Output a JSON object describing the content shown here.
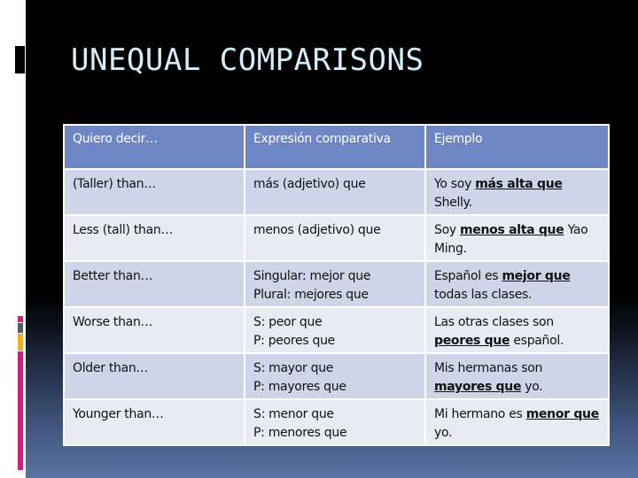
{
  "slide": {
    "title": "UNEQUAL COMPARISONS",
    "colors": {
      "background_top": "#000000",
      "background_bottom": "#5a74a5",
      "title_text": "#d7eefa",
      "header_fill": "#6f86c4",
      "row_odd_fill": "#cfd5e9",
      "row_even_fill": "#e8ebf4",
      "accent_magenta": "#d81b7a",
      "accent_gray": "#555a66",
      "accent_amber": "#f2ae1c"
    }
  },
  "table": {
    "headers": [
      "Quiero decir…",
      "Expresión comparativa",
      "Ejemplo"
    ],
    "rows": [
      {
        "meaning": "(Taller) than…",
        "expression": [
          "más (adjetivo) que"
        ],
        "example": {
          "before": "Yo soy ",
          "underlined": "más alta que",
          "after": " Shelly."
        }
      },
      {
        "meaning": "Less (tall) than…",
        "expression": [
          "menos (adjetivo) que"
        ],
        "example": {
          "before": "Soy ",
          "underlined": "menos alta que",
          "after": " Yao Ming."
        }
      },
      {
        "meaning": "Better than…",
        "expression": [
          "Singular: mejor que",
          "Plural: mejores que"
        ],
        "example": {
          "before": "Español es ",
          "underlined": "mejor que",
          "after": " todas las clases."
        }
      },
      {
        "meaning": "Worse than…",
        "expression": [
          "S: peor que",
          "P: peores que"
        ],
        "example": {
          "before": "Las otras clases son ",
          "underlined": "peores que",
          "after": " español."
        }
      },
      {
        "meaning": "Older than…",
        "expression": [
          "S: mayor que",
          "P: mayores que"
        ],
        "example": {
          "before": "Mis hermanas son ",
          "underlined": "mayores que",
          "after": " yo."
        }
      },
      {
        "meaning": "Younger than…",
        "expression": [
          "S: menor que",
          "P: menores que"
        ],
        "example": {
          "before": "Mi hermano es ",
          "underlined": "menor que",
          "after": " yo."
        }
      }
    ]
  }
}
